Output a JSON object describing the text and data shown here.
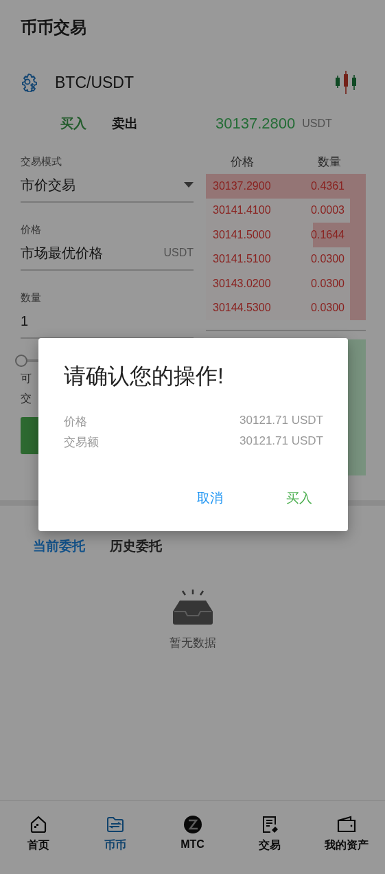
{
  "header": {
    "title": "币币交易"
  },
  "pair": {
    "name": "BTC/USDT"
  },
  "side_tabs": [
    {
      "label": "买入",
      "selected": true
    },
    {
      "label": "卖出",
      "selected": false
    }
  ],
  "last_price": {
    "value": "30137.2800",
    "unit": "USDT"
  },
  "form": {
    "mode_label": "交易模式",
    "mode_value": "市价交易",
    "price_label": "价格",
    "price_value": "市场最优价格",
    "price_unit": "USDT",
    "amount_label": "数量",
    "amount_value": "1",
    "slider": {
      "level": 0
    },
    "available_label": "可",
    "volume_label": "交"
  },
  "order_book": {
    "columns": [
      "价格",
      "数量"
    ],
    "asks": [
      {
        "price": "30137.2900",
        "amount": "0.4361",
        "level": 1
      },
      {
        "price": "30141.4100",
        "amount": "0.0003",
        "level": 0.1
      },
      {
        "price": "30141.5000",
        "amount": "0.1644",
        "level": 0.33
      },
      {
        "price": "30141.5100",
        "amount": "0.0300",
        "level": 0.1
      },
      {
        "price": "30143.0200",
        "amount": "0.0300",
        "level": 0.1
      },
      {
        "price": "30144.5300",
        "amount": "0.0300",
        "level": 0.1
      }
    ]
  },
  "order_tabs": [
    {
      "label": "当前委托",
      "selected": true
    },
    {
      "label": "历史委托",
      "selected": false
    }
  ],
  "empty": {
    "text": "暂无数据"
  },
  "nav": [
    {
      "label": "首页",
      "selected": false
    },
    {
      "label": "币币",
      "selected": true
    },
    {
      "label": "MTC",
      "selected": false
    },
    {
      "label": "交易",
      "selected": false
    },
    {
      "label": "我的资产",
      "selected": false
    }
  ],
  "dialog": {
    "title": "请确认您的操作!",
    "rows": [
      {
        "label": "价格",
        "value": "30121.71 USDT"
      },
      {
        "label": "交易额",
        "value": "30121.71 USDT"
      }
    ],
    "buttons": [
      {
        "label": "取消",
        "kind": "cancel"
      },
      {
        "label": "买入",
        "kind": "confirm"
      }
    ]
  }
}
